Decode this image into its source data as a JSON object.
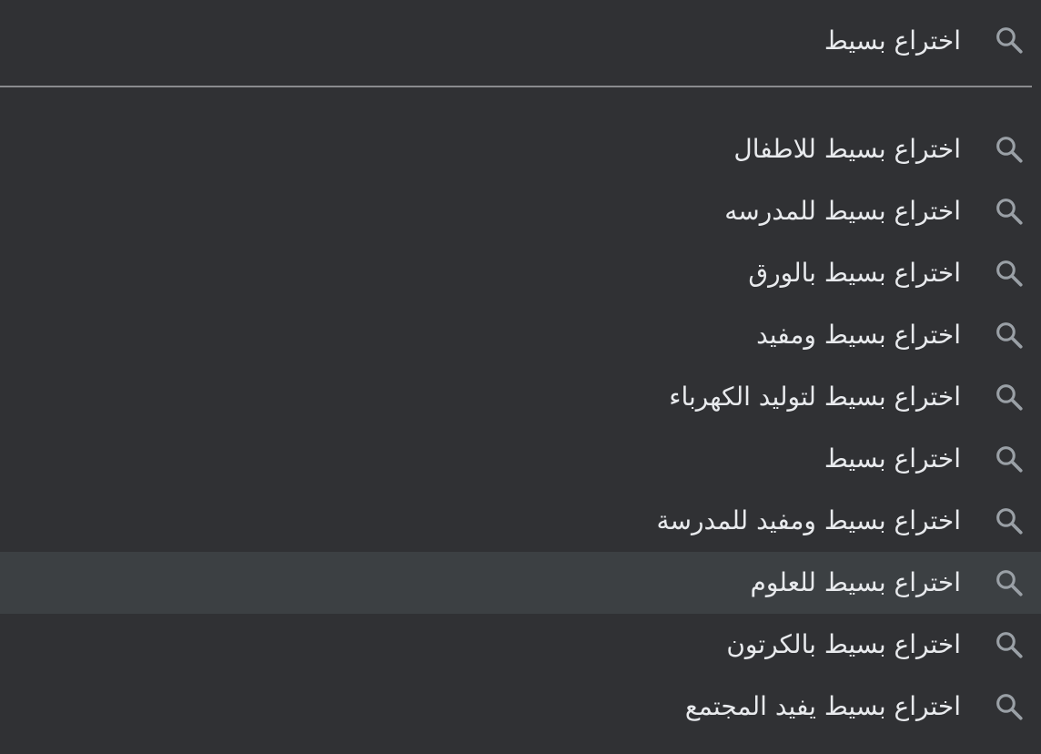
{
  "search": {
    "query": "اختراع بسيط",
    "icon": "search-icon"
  },
  "suggestions": [
    {
      "label": "اختراع بسيط للاطفال",
      "icon": "search-icon",
      "highlighted": false
    },
    {
      "label": "اختراع بسيط للمدرسه",
      "icon": "search-icon",
      "highlighted": false
    },
    {
      "label": "اختراع بسيط بالورق",
      "icon": "search-icon",
      "highlighted": false
    },
    {
      "label": "اختراع بسيط ومفيد",
      "icon": "search-icon",
      "highlighted": false
    },
    {
      "label": "اختراع بسيط لتوليد الكهرباء",
      "icon": "search-icon",
      "highlighted": false
    },
    {
      "label": "اختراع بسيط",
      "icon": "search-icon",
      "highlighted": false
    },
    {
      "label": "اختراع بسيط ومفيد للمدرسة",
      "icon": "search-icon",
      "highlighted": false
    },
    {
      "label": "اختراع بسيط للعلوم",
      "icon": "search-icon",
      "highlighted": true
    },
    {
      "label": "اختراع بسيط بالكرتون",
      "icon": "search-icon",
      "highlighted": false
    },
    {
      "label": "اختراع بسيط يفيد المجتمع",
      "icon": "search-icon",
      "highlighted": false
    }
  ],
  "colors": {
    "background": "#303134",
    "highlight": "#3c4043",
    "text": "#e8eaed",
    "icon": "#9aa0a6",
    "divider": "#8a8b8e"
  }
}
